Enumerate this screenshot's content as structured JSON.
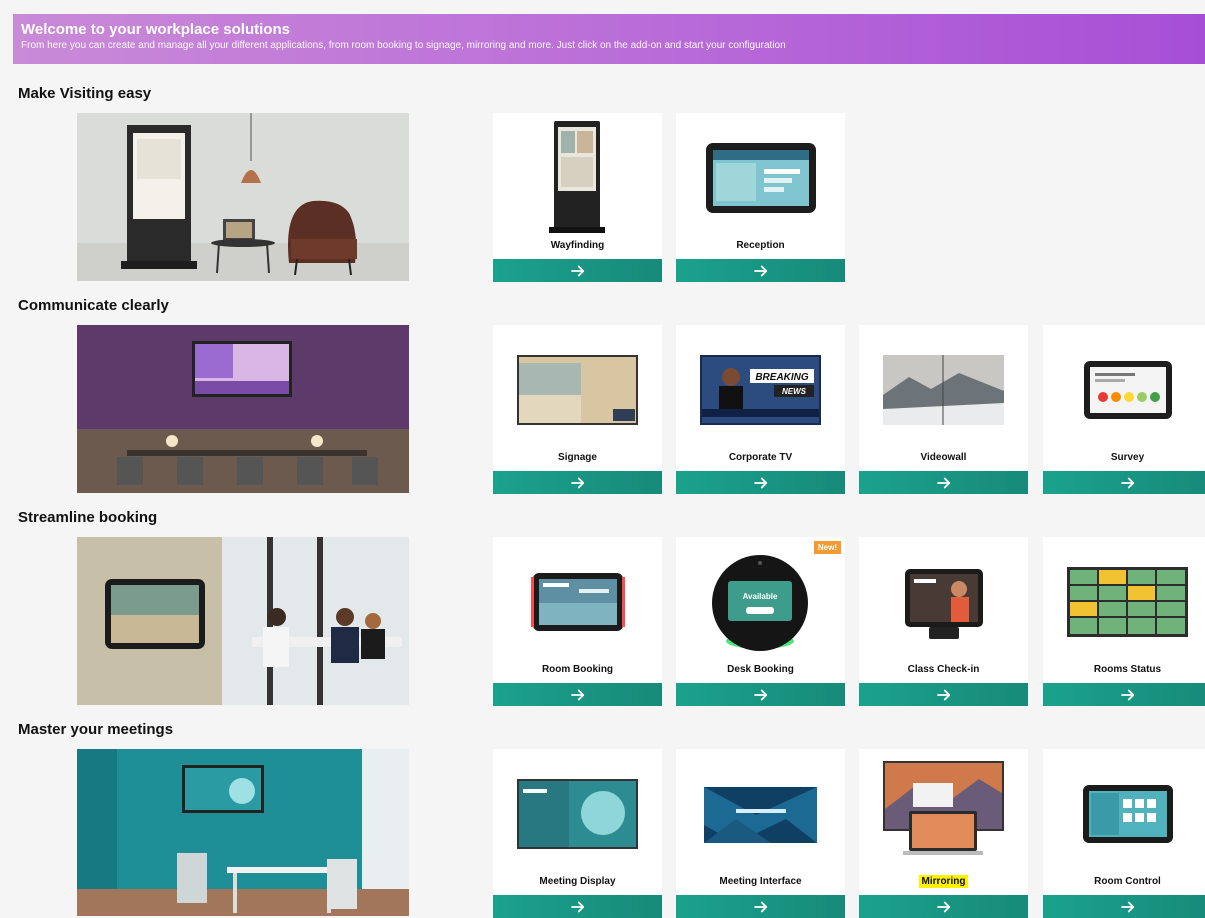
{
  "banner": {
    "title": "Welcome to your workplace solutions",
    "subtitle": "From here you can create and manage all your different applications, from room booking to signage, mirroring and more. Just click on the add-on and start your configuration"
  },
  "sections": [
    {
      "title": "Make Visiting easy",
      "cards": [
        {
          "label": "Wayfinding",
          "icon": "arrow-right-icon"
        },
        {
          "label": "Reception",
          "icon": "arrow-right-icon"
        }
      ]
    },
    {
      "title": "Communicate clearly",
      "cards": [
        {
          "label": "Signage"
        },
        {
          "label": "Corporate TV",
          "thumb_text": [
            "BREAKING",
            "NEWS"
          ]
        },
        {
          "label": "Videowall"
        },
        {
          "label": "Survey"
        }
      ]
    },
    {
      "title": "Streamline booking",
      "cards": [
        {
          "label": "Room Booking"
        },
        {
          "label": "Desk Booking",
          "badge": "New!",
          "thumb_text": "Available"
        },
        {
          "label": "Class Check-in"
        },
        {
          "label": "Rooms Status"
        }
      ]
    },
    {
      "title": "Master your meetings",
      "cards": [
        {
          "label": "Meeting Display"
        },
        {
          "label": "Meeting Interface"
        },
        {
          "label": "Mirroring",
          "highlighted": true
        },
        {
          "label": "Room Control"
        }
      ]
    }
  ],
  "colors": {
    "banner_start": "#c98ad8",
    "banner_end": "#a64fd6",
    "card_button": "#1aa28c",
    "badge": "#f39a34",
    "highlight": "#fff200"
  }
}
